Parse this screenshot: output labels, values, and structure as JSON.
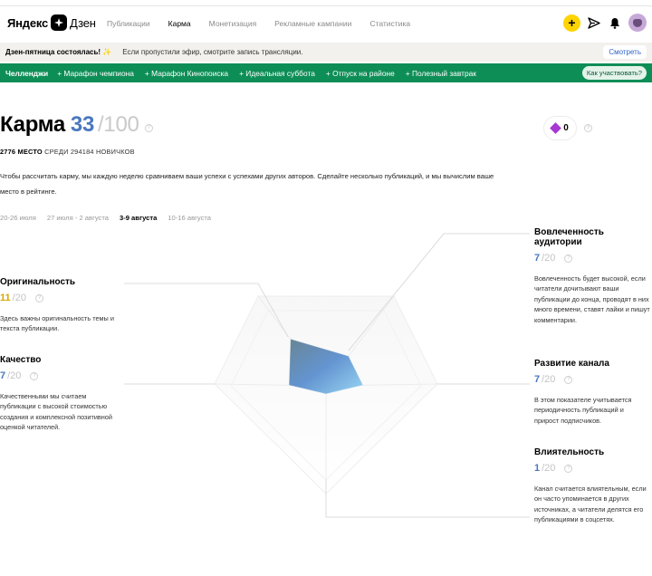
{
  "header": {
    "logo_brand": "Яндекс",
    "logo_name": "Дзен",
    "nav": [
      "Публикации",
      "Карма",
      "Монетизация",
      "Рекламные кампании",
      "Статистика"
    ],
    "active_nav": "Карма",
    "plus_label": "+"
  },
  "announcement": {
    "title": "Дзен-пятница состоялась! ✨",
    "text": "Если пропустили эфир, смотрите запись трансляции.",
    "button": "Смотреть"
  },
  "challenges": {
    "label": "Челленджи",
    "items": [
      "+ Марафон чемпиона",
      "+ Марафон Кинопоиска",
      "+ Идеальная суббота",
      "+ Отпуск на районе",
      "+ Полезный завтрак"
    ],
    "how_button": "Как участвовать?"
  },
  "karma": {
    "title": "Карма",
    "score": "33",
    "total": "/100",
    "place_number": "2776 МЕСТО",
    "place_text": " СРЕДИ 294184 НОВИЧКОВ",
    "gems": "0",
    "description": "Чтобы рассчитать карму, мы каждую неделю сравниваем ваши успехи с успехами других авторов. Сделайте несколько публикаций, и мы вычислим ваше место в рейтинге."
  },
  "weeks": [
    "20-26 июля",
    "27 июля - 2 августа",
    "3-9 августа",
    "10-16 августа"
  ],
  "active_week": "3-9 августа",
  "metrics": {
    "originality": {
      "title": "Оригинальность",
      "score": "11",
      "total": "/20",
      "score_color": "#d9a800",
      "description": "Здесь важны оригинальность темы и текста публикации."
    },
    "quality": {
      "title": "Качество",
      "score": "7",
      "total": "/20",
      "score_color": "#4a78be",
      "description": "Качественными мы считаем публикации с высокой стоимостью создания и комплексной позитивной оценкой читателей."
    },
    "engagement": {
      "title": "Вовлеченность аудитории",
      "score": "7",
      "total": "/20",
      "score_color": "#4a78be",
      "description": "Вовлеченность будет высокой, если читатели дочитывают ваши публикации до конца, проводят в них много времени, ставят лайки и пишут комментарии."
    },
    "growth": {
      "title": "Развитие канала",
      "score": "7",
      "total": "/20",
      "score_color": "#4a78be",
      "description": "В этом показателе учитывается периодичность публикаций и прирост подписчиков."
    },
    "influence": {
      "title": "Влиятельность",
      "score": "1",
      "total": "/20",
      "score_color": "#4a78be",
      "description": "Канал считается влиятельным, если он часто упоминается в других источниках, а читатели делятся его публикациями в соцсетях."
    }
  },
  "radar": {
    "max": 20,
    "values": [
      11,
      7,
      7,
      1,
      7
    ]
  },
  "colors": {
    "accent": "#4a78be",
    "challenge_bg": "#0e8e57",
    "plus": "#ffd400",
    "gem": "#a638d4"
  }
}
